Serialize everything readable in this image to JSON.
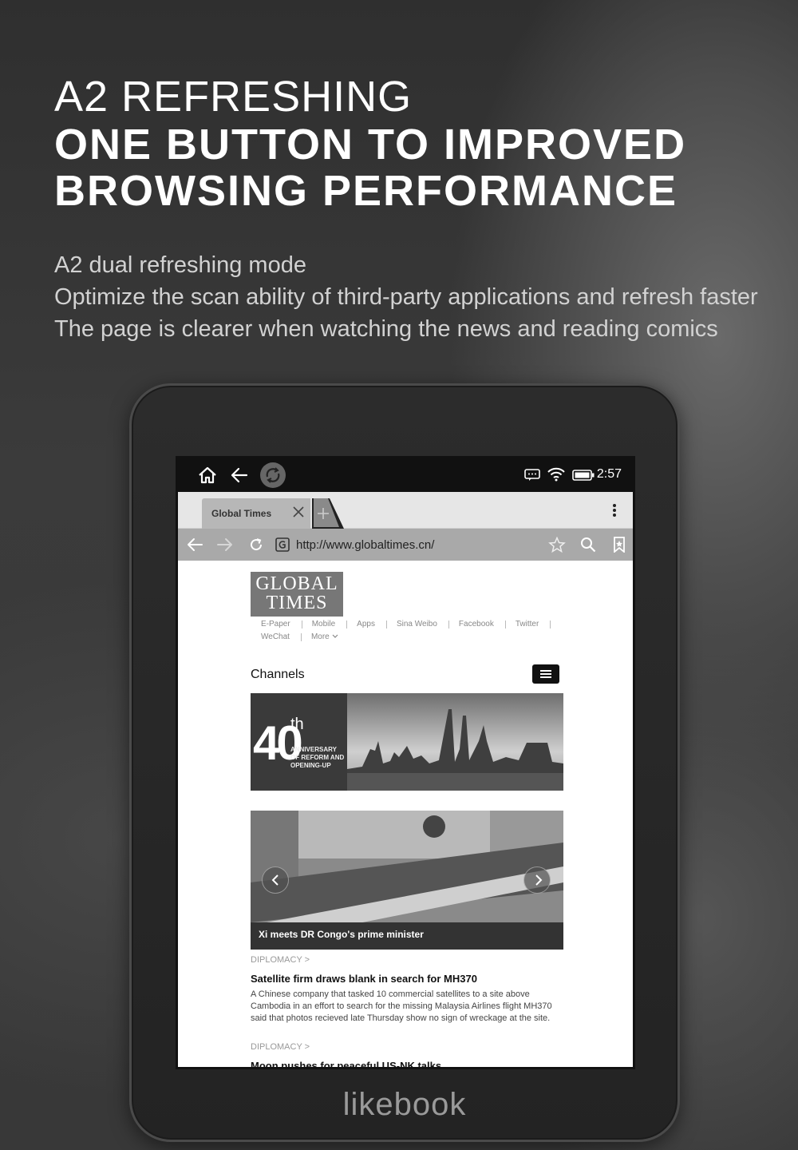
{
  "headline": {
    "line1": "A2 REFRESHING",
    "line2": "ONE BUTTON TO IMPROVED",
    "line3": "BROWSING PERFORMANCE"
  },
  "subtext": {
    "line1": "A2 dual refreshing mode",
    "line2": "Optimize the scan ability of third-party applications and refresh faster",
    "line3": "The page is clearer when watching the news and reading comics"
  },
  "device": {
    "brand": "likebook",
    "statusbar": {
      "time": "2:57",
      "icons": [
        "home-icon",
        "back-icon",
        "refresh-a2-icon",
        "message-icon",
        "wifi-icon",
        "battery-icon"
      ]
    },
    "browser": {
      "tab_label": "Global Times",
      "url": "http://www.globaltimes.cn/"
    },
    "page": {
      "logo_line1": "GLOBAL",
      "logo_line2": "TIMES",
      "links_row1": [
        "E-Paper",
        "Mobile",
        "Apps",
        "Sina Weibo",
        "Facebook",
        "Twitter"
      ],
      "links_row2": [
        "WeChat",
        "More"
      ],
      "channels": "Channels",
      "banner_num": "40",
      "banner_sup": "th",
      "banner_text": "ANNIVERSARY OF REFORM AND OPENING-UP",
      "photo_caption": "Xi meets DR Congo's prime minister",
      "articles": [
        {
          "category": "DIPLOMACY >",
          "title": "Satellite firm draws blank in search for MH370",
          "body": "A Chinese company that tasked 10 commercial satellites to a site above Cambodia in an effort to search for the missing Malaysia Airlines flight MH370 said that photos recieved late Thursday show no sign of wreckage at the site."
        },
        {
          "category": "DIPLOMACY >",
          "title": "Moon pushes for peaceful US-NK talks"
        }
      ]
    }
  }
}
